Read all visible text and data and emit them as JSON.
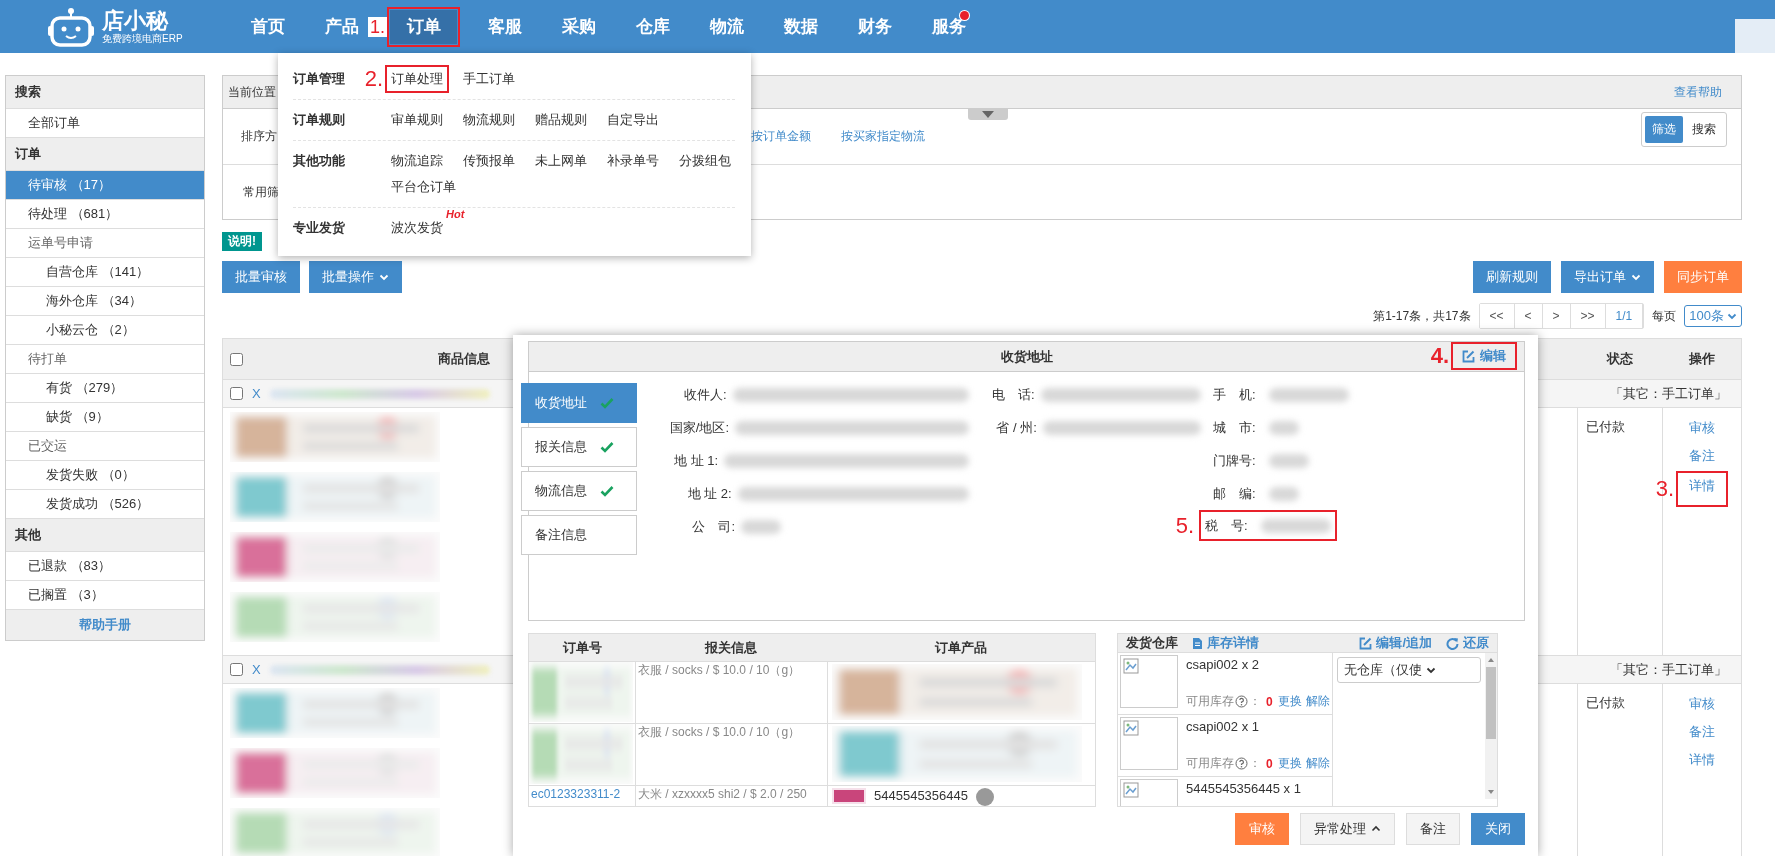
{
  "logo": {
    "name": "店小秘",
    "tagline": "免费跨境电商ERP"
  },
  "nav": [
    {
      "label": "首页",
      "selected": false,
      "dot": false
    },
    {
      "label": "产品",
      "selected": false,
      "dot": false
    },
    {
      "label": "订单",
      "selected": true,
      "dot": false,
      "annotation": "1."
    },
    {
      "label": "客服",
      "selected": false,
      "dot": false
    },
    {
      "label": "采购",
      "selected": false,
      "dot": false
    },
    {
      "label": "仓库",
      "selected": false,
      "dot": false
    },
    {
      "label": "物流",
      "selected": false,
      "dot": false
    },
    {
      "label": "数据",
      "selected": false,
      "dot": false
    },
    {
      "label": "财务",
      "selected": false,
      "dot": false
    },
    {
      "label": "服务",
      "selected": false,
      "dot": true
    }
  ],
  "menu": [
    {
      "title": "订单管理",
      "items": [
        {
          "label": "订单处理",
          "annotation": "2."
        },
        {
          "label": "手工订单"
        }
      ]
    },
    {
      "title": "订单规则",
      "items": [
        {
          "label": "审单规则"
        },
        {
          "label": "物流规则"
        },
        {
          "label": "赠品规则"
        },
        {
          "label": "自定导出"
        }
      ]
    },
    {
      "title": "其他功能",
      "items": [
        {
          "label": "物流追踪"
        },
        {
          "label": "传预报单"
        },
        {
          "label": "未上网单"
        },
        {
          "label": "补录单号"
        },
        {
          "label": "分拨组包"
        },
        {
          "label": "平台仓订单"
        }
      ]
    },
    {
      "title": "专业发货",
      "items": [
        {
          "label": "波次发货",
          "tag": "Hot"
        }
      ]
    }
  ],
  "sidebar": {
    "sections": [
      {
        "title": "搜索",
        "items": [
          {
            "label": "全部订单",
            "selected": false
          }
        ]
      },
      {
        "title": "订单",
        "items": [
          {
            "label": "待审核 （17）",
            "selected": true
          },
          {
            "label": "待处理 （681）",
            "selected": false
          },
          {
            "label": "运单号申请",
            "selected": false,
            "children": [
              {
                "label": "自营仓库 （141）",
                "selected": false
              },
              {
                "label": "海外仓库 （34）",
                "selected": false
              },
              {
                "label": "小秘云仓 （2）",
                "selected": false
              }
            ]
          },
          {
            "label": "待打单",
            "selected": false,
            "children": [
              {
                "label": "有货 （279）",
                "selected": false
              },
              {
                "label": "缺货 （9）",
                "selected": false
              }
            ]
          },
          {
            "label": "已交运",
            "selected": false,
            "children": [
              {
                "label": "发货失败 （0）",
                "selected": false
              },
              {
                "label": "发货成功 （526）",
                "selected": false
              }
            ]
          }
        ]
      },
      {
        "title": "其他",
        "items": [
          {
            "label": "已退款 （83）",
            "selected": false
          },
          {
            "label": "已搁置 （3）",
            "selected": false
          }
        ]
      }
    ],
    "footer": "帮助手册"
  },
  "location": {
    "label": "当前位置",
    "help": "查看帮助"
  },
  "sort": {
    "label": "排序方",
    "options": [
      "按订单金额",
      "按买家指定物流"
    ]
  },
  "view_toggle": [
    {
      "label": "筛选",
      "selected": true
    },
    {
      "label": "搜索",
      "selected": false
    }
  ],
  "common_filter": {
    "label": "常用筛"
  },
  "notice": "说明!",
  "bulk_buttons": [
    {
      "label": "批量审核",
      "dropdown": false
    },
    {
      "label": "批量操作",
      "dropdown": true
    }
  ],
  "action_buttons": [
    {
      "label": "刷新规则",
      "kind": "primary",
      "dropdown": false
    },
    {
      "label": "导出订单",
      "kind": "primary",
      "dropdown": true
    },
    {
      "label": "同步订单",
      "kind": "warning",
      "dropdown": false
    }
  ],
  "pagination": {
    "summary": "第1-17条，共17条",
    "pages": [
      {
        "label": "<<",
        "selected": false
      },
      {
        "label": "<",
        "selected": false
      },
      {
        "label": ">",
        "selected": false
      },
      {
        "label": ">>",
        "selected": false
      },
      {
        "label": "1/1",
        "selected": true
      }
    ],
    "per_page_label": "每页",
    "per_page": "100条"
  },
  "orders": {
    "columns": [
      "商品信息",
      "状态",
      "操作"
    ],
    "all_checked": false,
    "rows": [
      {
        "checked": false,
        "order_no": "X",
        "source": "「其它：手工订单」",
        "status": "已付款",
        "actions": [
          {
            "label": "审核"
          },
          {
            "label": "备注"
          },
          {
            "label": "详情",
            "annotation": "3."
          }
        ]
      },
      {
        "checked": false,
        "order_no": "X",
        "source": "「其它：手工订单」",
        "status": "已付款",
        "actions": [
          {
            "label": "审核"
          },
          {
            "label": "备注"
          },
          {
            "label": "详情"
          }
        ]
      }
    ]
  },
  "modal": {
    "address": {
      "title": "收货地址",
      "edit": {
        "label": "编辑",
        "annotation": "4."
      },
      "tabs": [
        {
          "label": "收货地址",
          "selected": true,
          "complete": true
        },
        {
          "label": "报关信息",
          "selected": false,
          "complete": true
        },
        {
          "label": "物流信息",
          "selected": false,
          "complete": true
        },
        {
          "label": "备注信息",
          "selected": false,
          "complete": false
        }
      ],
      "columns": [
        [
          {
            "label": "收件人:"
          },
          {
            "label": "国家/地区:"
          },
          {
            "label": "地 址 1:"
          },
          {
            "label": "地 址 2:"
          },
          {
            "label": "公　司:"
          }
        ],
        [
          {
            "label": "电　话:"
          },
          {
            "label": "省 / 州:"
          }
        ],
        [
          {
            "label": "手　机:"
          },
          {
            "label": "城　市:"
          },
          {
            "label": "门牌号:"
          },
          {
            "label": "邮　编:"
          },
          {
            "label": "税　号:",
            "annotation": "5."
          }
        ]
      ]
    },
    "items": {
      "columns": [
        "订单号",
        "报关信息",
        "订单产品"
      ],
      "rows": [
        {
          "customs": "衣服 / socks / $ 10.0 / 10（g）"
        },
        {
          "customs": "衣服 / socks / $ 10.0 / 10（g）"
        },
        {
          "order_no": "ec0123323311-2",
          "customs": "大米 / xzxxxx5 shi2 / $ 2.0 / 250",
          "product": "5445545356445"
        }
      ]
    },
    "warehouse": {
      "title": "发货仓库",
      "links": [
        {
          "label": "库存详情"
        },
        {
          "label": "编辑/追加"
        },
        {
          "label": "还原"
        }
      ],
      "select": "无仓库（仅使",
      "rows": [
        {
          "sku": "csapi002 x 2",
          "stock_label": "可用库存",
          "colon": "：",
          "stock": "0",
          "actions": [
            "更换",
            "解除"
          ]
        },
        {
          "sku": "csapi002 x 1",
          "stock_label": "可用库存",
          "colon": "：",
          "stock": "0",
          "actions": [
            "更换",
            "解除"
          ]
        },
        {
          "sku": "5445545356445 x 1"
        }
      ]
    },
    "buttons": [
      {
        "label": "审核",
        "kind": "warning",
        "dropup": false
      },
      {
        "label": "异常处理",
        "kind": "default",
        "dropup": true
      },
      {
        "label": "备注",
        "kind": "default",
        "dropup": false
      },
      {
        "label": "关闭",
        "kind": "primary",
        "dropup": false
      }
    ]
  }
}
